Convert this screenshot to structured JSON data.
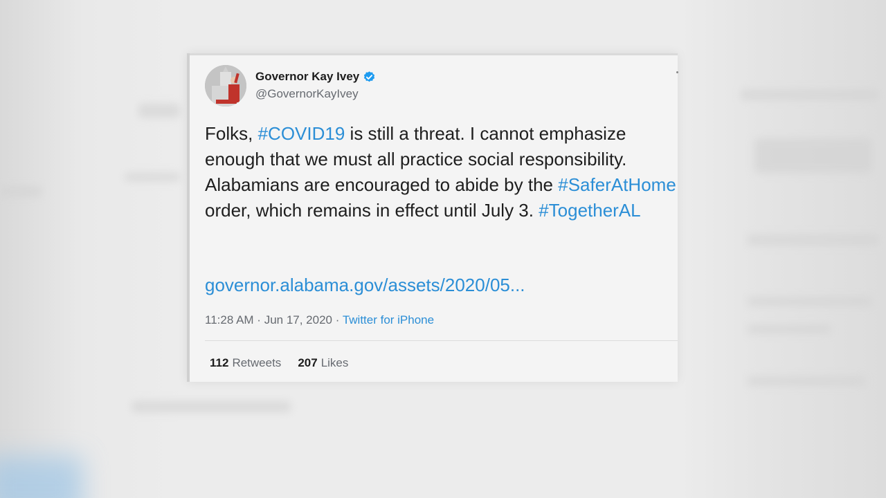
{
  "tweet": {
    "author_name": "Governor Kay Ivey",
    "author_handle": "@GovernorKayIvey",
    "text_parts": {
      "p1": "Folks, ",
      "h1": "#COVID19",
      "p2": " is still a threat. I cannot emphasize enough that we must all practice social responsibility. Alabamians are encouraged to abide by the ",
      "h2": "#SaferAtHome",
      "p3": " order, which remains in effect until July 3. ",
      "h3": "#TogetherAL"
    },
    "link": "governor.alabama.gov/assets/2020/05...",
    "time": "11:28 AM",
    "date": "Jun 17, 2020",
    "separator": " · ",
    "source": "Twitter for iPhone",
    "retweets_count": "112",
    "retweets_label": "Retweets",
    "likes_count": "207",
    "likes_label": "Likes"
  },
  "colors": {
    "hashtag": "#2b8ed6",
    "verified": "#1d9bf0",
    "text": "#1e1e1e",
    "muted": "#666a70"
  },
  "icons": {
    "verified": "verified-badge-icon",
    "avatar": "user-avatar"
  }
}
